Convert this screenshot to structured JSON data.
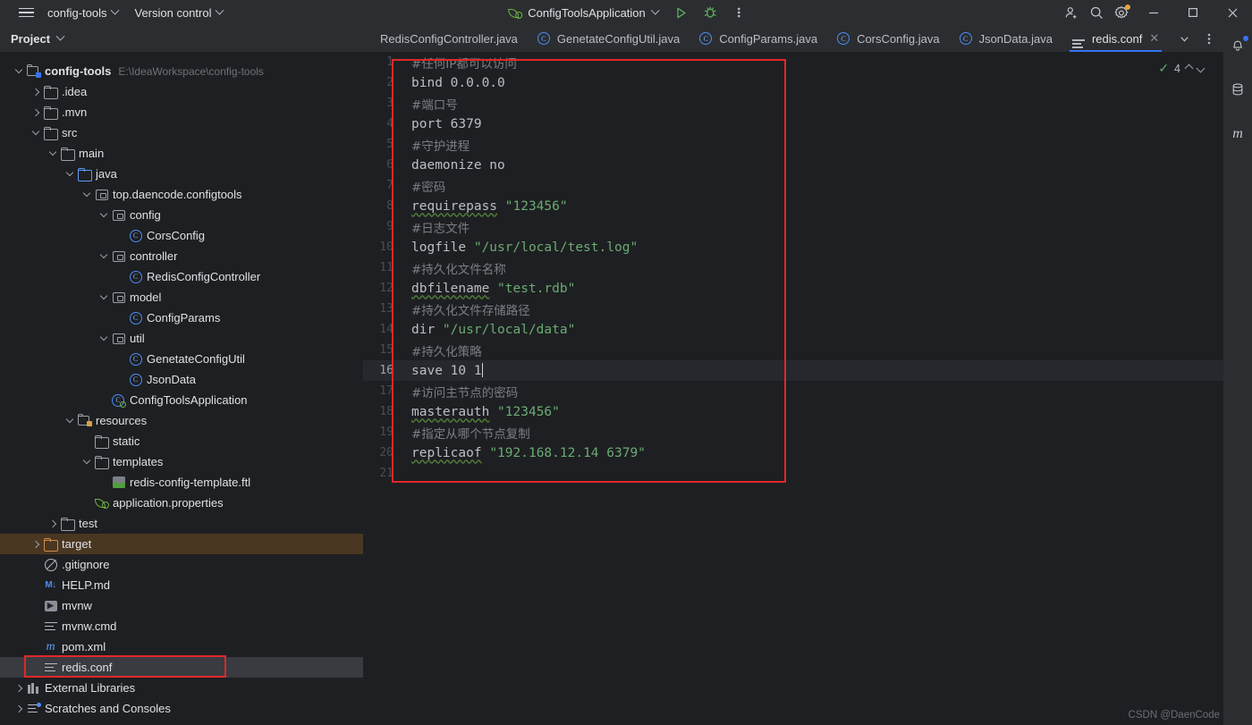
{
  "titlebar": {
    "hamburger_icon": "hamburger-menu-icon",
    "project_menu": "config-tools",
    "vcs_menu": "Version control",
    "run_config": "ConfigToolsApplication",
    "run_icon": "run-play-icon",
    "debug_icon": "debug-bug-icon",
    "more_icon": "more-vertical-icon",
    "account_icon": "account-add-icon",
    "search_icon": "search-icon",
    "settings_icon": "settings-gear-icon",
    "minimize": "–",
    "maximize": "☐",
    "close": "✕"
  },
  "project_panel": {
    "title": "Project",
    "tree": [
      {
        "depth": 0,
        "arrow": "down",
        "icon": "project-module-icon",
        "label": "config-tools",
        "sub": "E:\\IdeaWorkspace\\config-tools",
        "bold": true
      },
      {
        "depth": 1,
        "arrow": "right",
        "icon": "folder-icon",
        "label": ".idea",
        "sub": ""
      },
      {
        "depth": 1,
        "arrow": "right",
        "icon": "folder-icon",
        "label": ".mvn",
        "sub": ""
      },
      {
        "depth": 1,
        "arrow": "down",
        "icon": "folder-icon",
        "label": "src",
        "sub": ""
      },
      {
        "depth": 2,
        "arrow": "down",
        "icon": "folder-icon",
        "label": "main",
        "sub": ""
      },
      {
        "depth": 3,
        "arrow": "down",
        "icon": "source-folder-icon",
        "label": "java",
        "sub": ""
      },
      {
        "depth": 4,
        "arrow": "down",
        "icon": "package-icon",
        "label": "top.daencode.configtools",
        "sub": ""
      },
      {
        "depth": 5,
        "arrow": "down",
        "icon": "package-icon",
        "label": "config",
        "sub": ""
      },
      {
        "depth": 6,
        "arrow": "none",
        "icon": "java-class-icon",
        "label": "CorsConfig",
        "sub": ""
      },
      {
        "depth": 5,
        "arrow": "down",
        "icon": "package-icon",
        "label": "controller",
        "sub": ""
      },
      {
        "depth": 6,
        "arrow": "none",
        "icon": "java-class-icon",
        "label": "RedisConfigController",
        "sub": ""
      },
      {
        "depth": 5,
        "arrow": "down",
        "icon": "package-icon",
        "label": "model",
        "sub": ""
      },
      {
        "depth": 6,
        "arrow": "none",
        "icon": "java-class-icon",
        "label": "ConfigParams",
        "sub": ""
      },
      {
        "depth": 5,
        "arrow": "down",
        "icon": "package-icon",
        "label": "util",
        "sub": ""
      },
      {
        "depth": 6,
        "arrow": "none",
        "icon": "java-class-icon",
        "label": "GenetateConfigUtil",
        "sub": ""
      },
      {
        "depth": 6,
        "arrow": "none",
        "icon": "java-class-icon",
        "label": "JsonData",
        "sub": ""
      },
      {
        "depth": 5,
        "arrow": "none",
        "icon": "spring-boot-class-icon",
        "label": "ConfigToolsApplication",
        "sub": ""
      },
      {
        "depth": 3,
        "arrow": "down",
        "icon": "resources-folder-icon",
        "label": "resources",
        "sub": ""
      },
      {
        "depth": 4,
        "arrow": "none",
        "icon": "folder-icon",
        "label": "static",
        "sub": ""
      },
      {
        "depth": 4,
        "arrow": "down",
        "icon": "folder-icon",
        "label": "templates",
        "sub": ""
      },
      {
        "depth": 5,
        "arrow": "none",
        "icon": "ftl-template-icon",
        "label": "redis-config-template.ftl",
        "sub": ""
      },
      {
        "depth": 4,
        "arrow": "none",
        "icon": "spring-properties-icon",
        "label": "application.properties",
        "sub": ""
      },
      {
        "depth": 2,
        "arrow": "right",
        "icon": "folder-icon",
        "label": "test",
        "sub": ""
      },
      {
        "depth": 1,
        "arrow": "right",
        "icon": "excluded-folder-icon",
        "label": "target",
        "sub": "",
        "state": "excluded"
      },
      {
        "depth": 1,
        "arrow": "none",
        "icon": "gitignore-icon",
        "label": ".gitignore",
        "sub": ""
      },
      {
        "depth": 1,
        "arrow": "none",
        "icon": "markdown-icon",
        "label": "HELP.md",
        "sub": ""
      },
      {
        "depth": 1,
        "arrow": "none",
        "icon": "shell-script-icon",
        "label": "mvnw",
        "sub": ""
      },
      {
        "depth": 1,
        "arrow": "none",
        "icon": "text-file-icon",
        "label": "mvnw.cmd",
        "sub": ""
      },
      {
        "depth": 1,
        "arrow": "none",
        "icon": "maven-pom-icon",
        "label": "pom.xml",
        "sub": ""
      },
      {
        "depth": 1,
        "arrow": "none",
        "icon": "text-file-icon",
        "label": "redis.conf",
        "sub": "",
        "state": "selected"
      },
      {
        "depth": 0,
        "arrow": "right",
        "icon": "external-libraries-icon",
        "label": "External Libraries",
        "sub": ""
      },
      {
        "depth": 0,
        "arrow": "right",
        "icon": "scratches-icon",
        "label": "Scratches and Consoles",
        "sub": ""
      }
    ]
  },
  "editor": {
    "tabs": [
      {
        "label": "RedisConfigController.java",
        "icon": "java-class-icon",
        "active": false,
        "clipped": true
      },
      {
        "label": "GenetateConfigUtil.java",
        "icon": "java-class-icon",
        "active": false
      },
      {
        "label": "ConfigParams.java",
        "icon": "java-class-icon",
        "active": false
      },
      {
        "label": "CorsConfig.java",
        "icon": "java-class-icon",
        "active": false
      },
      {
        "label": "JsonData.java",
        "icon": "java-class-icon",
        "active": false
      },
      {
        "label": "redis.conf",
        "icon": "text-file-icon",
        "active": true,
        "close": "✕"
      }
    ],
    "tab_list_icon": "chevron-down-icon",
    "tab_more_icon": "more-vertical-icon",
    "inspection": {
      "status_icon": "inspection-ok-icon",
      "count": "4",
      "prev_icon": "chevron-up-icon",
      "next_icon": "chevron-down-icon"
    },
    "lines": [
      {
        "n": "1",
        "tokens": [
          {
            "t": "comment",
            "v": "#任何IP都可以访问"
          }
        ]
      },
      {
        "n": "2",
        "tokens": [
          {
            "t": "plain",
            "v": "bind 0.0.0.0"
          }
        ]
      },
      {
        "n": "3",
        "tokens": [
          {
            "t": "comment",
            "v": "#端口号"
          }
        ]
      },
      {
        "n": "4",
        "tokens": [
          {
            "t": "plain",
            "v": "port 6379"
          }
        ]
      },
      {
        "n": "5",
        "tokens": [
          {
            "t": "comment",
            "v": "#守护进程"
          }
        ]
      },
      {
        "n": "6",
        "tokens": [
          {
            "t": "plain",
            "v": "daemonize no"
          }
        ]
      },
      {
        "n": "7",
        "tokens": [
          {
            "t": "comment",
            "v": "#密码"
          }
        ]
      },
      {
        "n": "8",
        "tokens": [
          {
            "t": "key",
            "v": "requirepass"
          },
          {
            "t": "plain",
            "v": " "
          },
          {
            "t": "string",
            "v": "\"123456\""
          }
        ]
      },
      {
        "n": "9",
        "tokens": [
          {
            "t": "comment",
            "v": "#日志文件"
          }
        ]
      },
      {
        "n": "10",
        "tokens": [
          {
            "t": "plain",
            "v": "logfile "
          },
          {
            "t": "string",
            "v": "\"/usr/local/test.log\""
          }
        ]
      },
      {
        "n": "11",
        "tokens": [
          {
            "t": "comment",
            "v": "#持久化文件名称"
          }
        ]
      },
      {
        "n": "12",
        "tokens": [
          {
            "t": "key",
            "v": "dbfilename"
          },
          {
            "t": "plain",
            "v": " "
          },
          {
            "t": "string",
            "v": "\"test.rdb\""
          }
        ]
      },
      {
        "n": "13",
        "tokens": [
          {
            "t": "comment",
            "v": "#持久化文件存储路径"
          }
        ]
      },
      {
        "n": "14",
        "tokens": [
          {
            "t": "plain",
            "v": "dir "
          },
          {
            "t": "string",
            "v": "\"/usr/local/data\""
          }
        ]
      },
      {
        "n": "15",
        "tokens": [
          {
            "t": "comment",
            "v": "#持久化策略"
          }
        ]
      },
      {
        "n": "16",
        "tokens": [
          {
            "t": "plain",
            "v": "save 10 1"
          },
          {
            "t": "caret",
            "v": ""
          }
        ],
        "current": true
      },
      {
        "n": "17",
        "tokens": [
          {
            "t": "comment",
            "v": "#访问主节点的密码"
          }
        ]
      },
      {
        "n": "18",
        "tokens": [
          {
            "t": "key",
            "v": "masterauth"
          },
          {
            "t": "plain",
            "v": " "
          },
          {
            "t": "string",
            "v": "\"123456\""
          }
        ]
      },
      {
        "n": "19",
        "tokens": [
          {
            "t": "comment",
            "v": "#指定从哪个节点复制"
          }
        ]
      },
      {
        "n": "20",
        "tokens": [
          {
            "t": "key",
            "v": "replicaof"
          },
          {
            "t": "plain",
            "v": " "
          },
          {
            "t": "string",
            "v": "\"192.168.12.14 6379\""
          }
        ]
      },
      {
        "n": "21",
        "tokens": []
      }
    ]
  },
  "right_sidebar": {
    "items": [
      {
        "icon": "notifications-bell-icon",
        "badge": true
      },
      {
        "icon": "database-icon",
        "badge": false
      },
      {
        "icon": "maven-icon",
        "badge": false
      }
    ]
  },
  "watermark": "CSDN @DaenCode",
  "colors": {
    "accent_blue": "#3574f0",
    "annotation_red": "#e02828",
    "excluded_orange": "#4a3722",
    "string_green": "#6aab73",
    "comment_gray": "#7a7e85",
    "panel_bg": "#2b2d30",
    "editor_bg": "#1e1f22",
    "spring_green": "#6db33f"
  }
}
